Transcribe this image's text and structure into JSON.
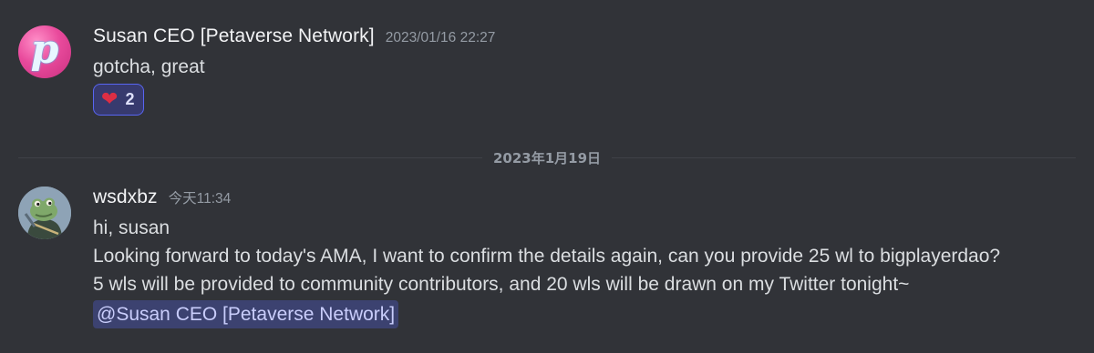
{
  "messages": [
    {
      "username": "Susan CEO [Petaverse Network]",
      "timestamp": "2023/01/16 22:27",
      "avatar_glyph": "p",
      "lines": [
        "gotcha, great"
      ],
      "reaction": {
        "icon": "heart-icon",
        "emoji": "❤",
        "count": "2"
      }
    },
    {
      "username": "wsdxbz",
      "timestamp": "今天11:34",
      "lines": [
        "hi, susan",
        "Looking forward to today's AMA, I want to confirm the details again, can you provide 25 wl to bigplayerdao?",
        "5 wls will be provided to community contributors, and 20 wls will be drawn on my Twitter tonight~"
      ],
      "mention": "@Susan CEO [Petaverse Network]"
    }
  ],
  "date_divider": "2023年1月19日",
  "colors": {
    "background": "#313338",
    "reaction_bg": "#373a6e",
    "reaction_border": "#5865f2",
    "mention_bg": "#3c4270",
    "mention_text": "#c9cdfb"
  }
}
